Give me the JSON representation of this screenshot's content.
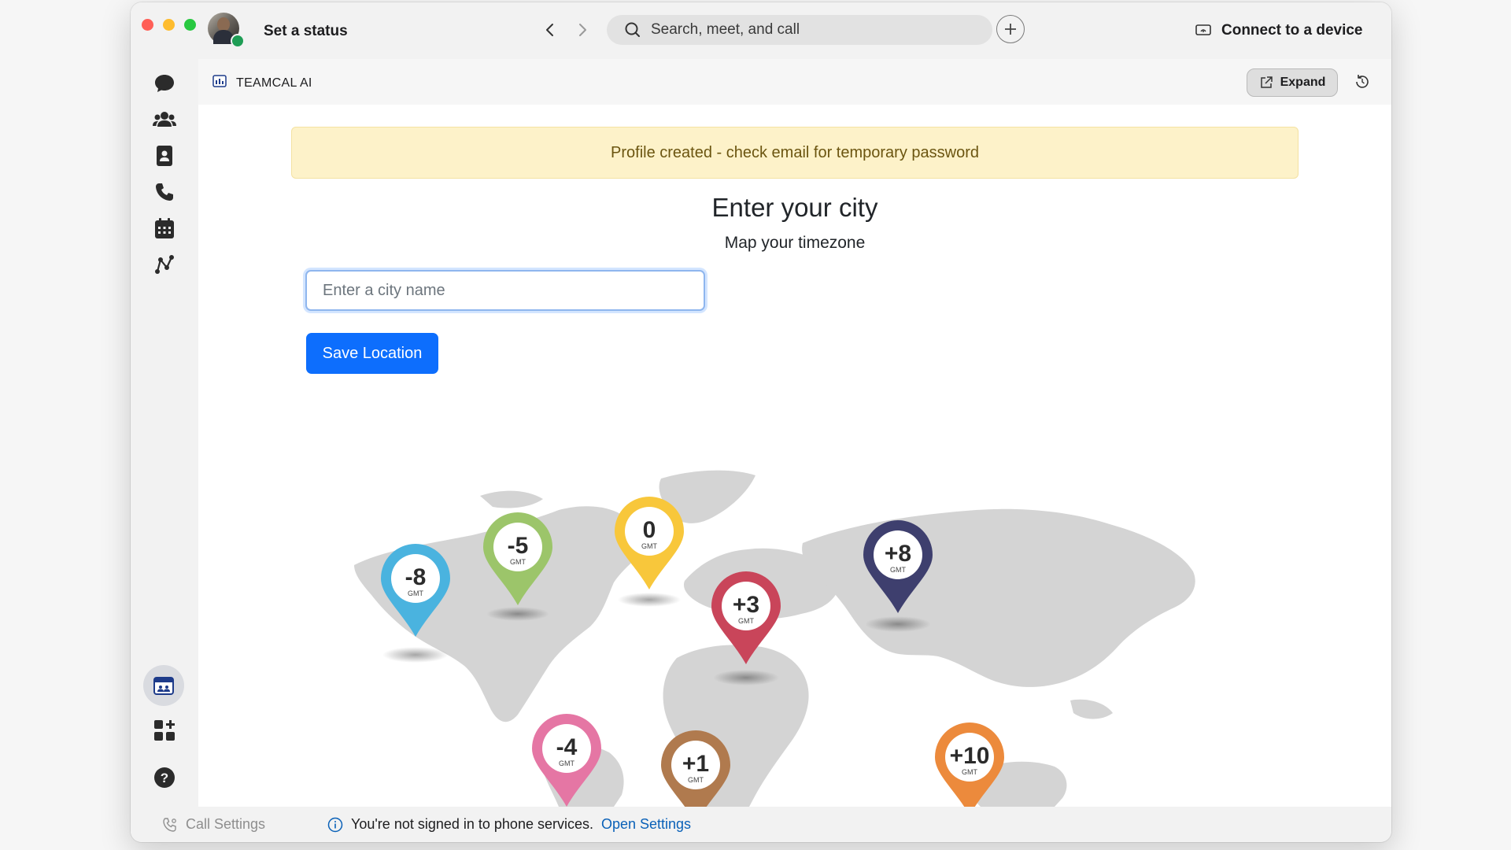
{
  "titlebar": {
    "status_label": "Set a status",
    "search_placeholder": "Search, meet, and call",
    "connect_label": "Connect to a device"
  },
  "rail": {
    "items": [
      "chat-icon",
      "teams-icon",
      "contacts-icon",
      "calls-icon",
      "calendar-icon",
      "workflows-icon"
    ],
    "bottom": [
      "teamcal-app-icon",
      "apps-icon",
      "help-icon"
    ]
  },
  "app": {
    "title": "TEAMCAL AI",
    "expand_label": "Expand"
  },
  "main": {
    "alert": "Profile created - check email for temporary password",
    "heading": "Enter your city",
    "subheading": "Map your timezone",
    "city_placeholder": "Enter a city name",
    "save_label": "Save Location"
  },
  "map": {
    "pins": [
      {
        "label": "-8",
        "sub": "GMT",
        "color": "#4ab3df"
      },
      {
        "label": "-5",
        "sub": "GMT",
        "color": "#9cc56a"
      },
      {
        "label": "0",
        "sub": "GMT",
        "color": "#f8c73b"
      },
      {
        "label": "+3",
        "sub": "GMT",
        "color": "#c9455a"
      },
      {
        "label": "+8",
        "sub": "GMT",
        "color": "#3e3f6e"
      },
      {
        "label": "-4",
        "sub": "GMT",
        "color": "#e576a4"
      },
      {
        "label": "+1",
        "sub": "GMT",
        "color": "#b07a4e"
      },
      {
        "label": "+10",
        "sub": "GMT",
        "color": "#ec8a3c"
      }
    ]
  },
  "footer": {
    "call_settings": "Call Settings",
    "phone_message": "You're not signed in to phone services.",
    "open_settings": "Open Settings"
  },
  "colors": {
    "primary": "#0d6efd",
    "alert_bg": "#fdf2c9",
    "alert_text": "#6b5510",
    "link": "#0a61b8"
  }
}
